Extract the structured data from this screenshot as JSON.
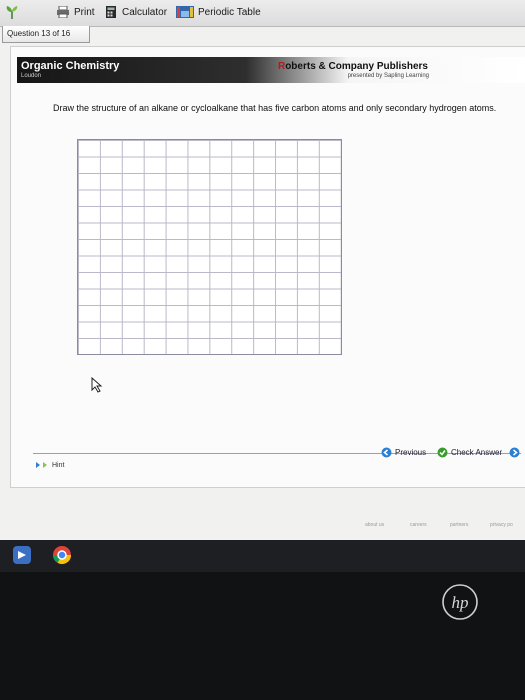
{
  "toolbar": {
    "print_label": "Print",
    "calculator_label": "Calculator",
    "periodic_table_label": "Periodic Table"
  },
  "question_tab": {
    "label": "Question 13 of 16"
  },
  "banner": {
    "course_title": "Organic Chemistry",
    "author": "Loudon",
    "publisher_initial": "R",
    "publisher_rest": "oberts & Company Publishers",
    "presented_by": "presented by Sapling Learning"
  },
  "question": {
    "text": "Draw the structure of an alkane or cycloalkane that has five carbon atoms and only secondary hydrogen atoms."
  },
  "nav": {
    "previous_label": "Previous",
    "check_answer_label": "Check Answer"
  },
  "hint": {
    "label": "Hint"
  },
  "footer": {
    "links": [
      "about us",
      "careers",
      "partners",
      "privacy po"
    ]
  },
  "brand": {
    "hp": "hp"
  },
  "colors": {
    "banner_dark": "#161616",
    "publisher_accent": "#b31a1a",
    "nav_icon": "#2f7fd0",
    "check_icon": "#3a9b2e"
  }
}
